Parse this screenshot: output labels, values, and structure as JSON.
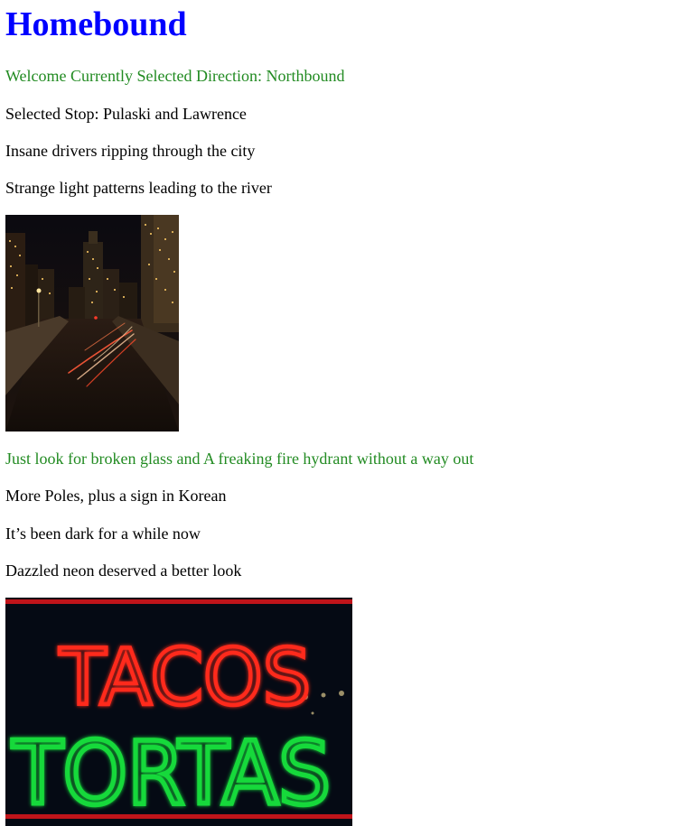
{
  "heading": "Homebound",
  "lines": {
    "welcome": "Welcome Currently Selected Direction: Northbound",
    "stop": "Selected Stop: Pulaski and Lawrence",
    "drivers": "Insane drivers ripping through the city",
    "patterns": "Strange light patterns leading to the river",
    "glass": "Just look for broken glass and A freaking fire hydrant without a way out",
    "poles": "More Poles, plus a sign in Korean",
    "dark": "It’s been dark for a while now",
    "neon": "Dazzled neon deserved a better look"
  },
  "images": {
    "city": {
      "alt": "Night city highway with light trails and skyscrapers"
    },
    "neon": {
      "alt": "Neon sign reading TACOS TORTAS",
      "sign_top": "TACOS",
      "sign_bottom": "TORTAS"
    }
  },
  "colors": {
    "heading": "#0000ff",
    "green_text": "#228b22",
    "neon_red": "#ff2a1a",
    "neon_green": "#19d93a"
  }
}
